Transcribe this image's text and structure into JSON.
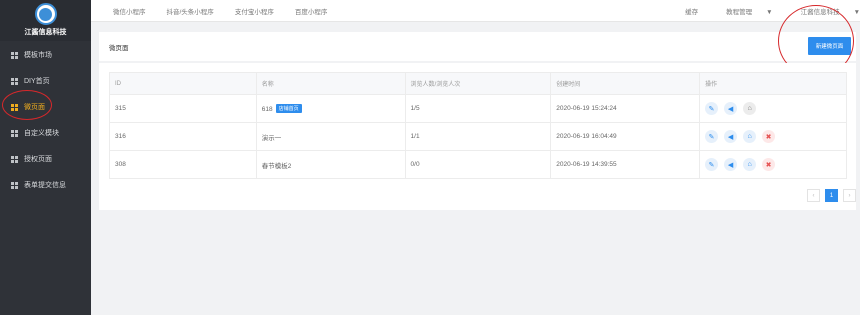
{
  "brand": {
    "name": "江酱信息科技"
  },
  "sidebar": {
    "items": [
      {
        "label": "模板市场"
      },
      {
        "label": "DIY首页"
      },
      {
        "label": "微页面"
      },
      {
        "label": "自定义模块"
      },
      {
        "label": "授权页面"
      },
      {
        "label": "表单提交信息"
      }
    ]
  },
  "topnav": {
    "tabs": [
      "微信小程序",
      "抖音/头条小程序",
      "支付宝小程序",
      "百度小程序"
    ],
    "right": {
      "cache": "缓存",
      "tutorial": "教程管理",
      "company": "江酱信息科技"
    }
  },
  "page": {
    "title": "微页面",
    "new_button": "新建微页面"
  },
  "table": {
    "headers": [
      "ID",
      "名称",
      "浏览人数/浏览人次",
      "创建时间",
      "操作"
    ],
    "rows": [
      {
        "id": "315",
        "name": "618",
        "badge": "店铺首页",
        "views": "1/5",
        "created": "2020-06-19 15:24:24",
        "deletable": false
      },
      {
        "id": "316",
        "name": "演示一",
        "badge": "",
        "views": "1/1",
        "created": "2020-06-19 16:04:49",
        "deletable": true
      },
      {
        "id": "308",
        "name": "春节模板2",
        "badge": "",
        "views": "0/0",
        "created": "2020-06-19 14:39:55",
        "deletable": true
      }
    ]
  },
  "pagination": {
    "prev": "‹",
    "current": "1",
    "next": "›"
  },
  "colors": {
    "sidebar_bg": "#2f3238",
    "active": "#f0ad1e",
    "primary": "#2e8ded",
    "annotation": "#d6282b"
  },
  "icons": {
    "edit": "pencil-icon",
    "promote": "megaphone-icon",
    "home": "home-icon",
    "delete": "trash-icon"
  }
}
